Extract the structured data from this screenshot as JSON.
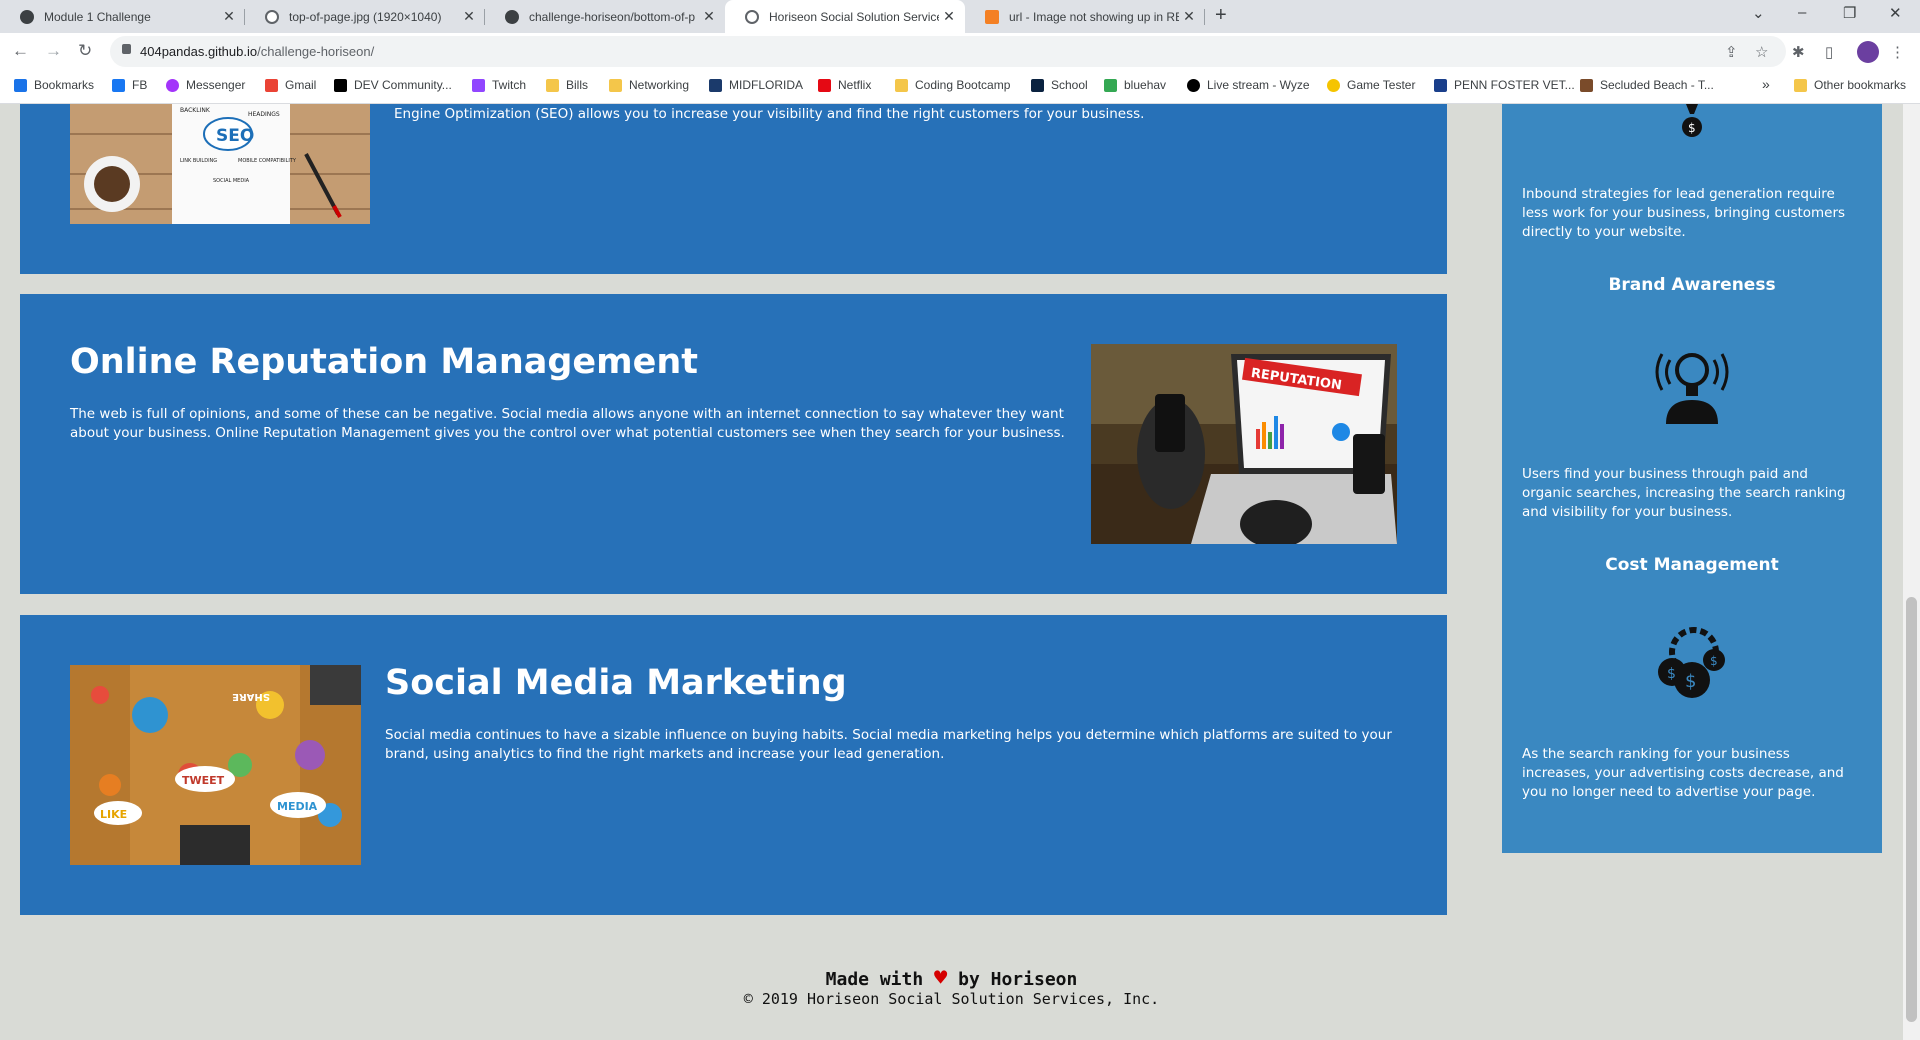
{
  "browser": {
    "tabs": [
      {
        "title": "Module 1 Challenge",
        "active": false
      },
      {
        "title": "top-of-page.jpg (1920×1040)",
        "active": false
      },
      {
        "title": "challenge-horiseon/bottom-of-p",
        "active": false
      },
      {
        "title": "Horiseon Social Solution Services",
        "active": true
      },
      {
        "title": "url - Image not showing up in RE",
        "active": false
      }
    ],
    "url_host": "404pandas.github.io",
    "url_path": "/challenge-horiseon/",
    "bookmarks": [
      "Bookmarks",
      "FB",
      "Messenger",
      "Gmail",
      "DEV Community...",
      "Twitch",
      "Bills",
      "Networking",
      "MIDFLORIDA",
      "Netflix",
      "Coding Bootcamp",
      "School",
      "bluehav",
      "Live stream - Wyze",
      "Game Tester",
      "PENN FOSTER VET...",
      "Secluded Beach - T..."
    ],
    "overflow_label": "»",
    "other_bookmarks": "Other bookmarks"
  },
  "page": {
    "seo": {
      "text": "Engine Optimization (SEO) allows you to increase your visibility and find the right customers for your business.",
      "image_labels": {
        "seo": "SEO",
        "backlink": "BACKLINK",
        "headings": "HEADINGS",
        "link_building": "LINK BUILDING",
        "mobile": "MOBILE COMPATIBILITY",
        "social": "SOCIAL MEDIA"
      }
    },
    "reputation": {
      "title": "Online Reputation Management",
      "text": "The web is full of opinions, and some of these can be negative. Social media allows anyone with an internet connection to say whatever they want about your business. Online Reputation Management gives you the control over what potential customers see when they search for your business.",
      "image_label": "REPUTATION"
    },
    "social": {
      "title": "Social Media Marketing",
      "text": "Social media continues to have a sizable influence on buying habits. Social media marketing helps you determine which platforms are suited to your brand, using analytics to find the right markets and increase your lead generation.",
      "image_labels": {
        "share": "SHARE",
        "tweet": "TWEET",
        "like": "LIKE",
        "media": "MEDIA"
      }
    },
    "aside": {
      "lead_text": "Inbound strategies for lead generation require less work for your business, bringing customers directly to your website.",
      "brand_title": "Brand Awareness",
      "brand_text": "Users find your business through paid and organic searches, increasing the search ranking and visibility for your business.",
      "cost_title": "Cost Management",
      "cost_text": "As the search ranking for your business increases, your advertising costs decrease, and you no longer need to advertise your page."
    },
    "footer": {
      "made_with": "Made with",
      "by": "by Horiseon",
      "copyright": "© 2019 Horiseon Social Solution Services, Inc."
    }
  },
  "colors": {
    "card": "#2771b8",
    "aside": "#3a88c1",
    "page_bg": "#d9dbd6",
    "heart": "#d50000"
  }
}
